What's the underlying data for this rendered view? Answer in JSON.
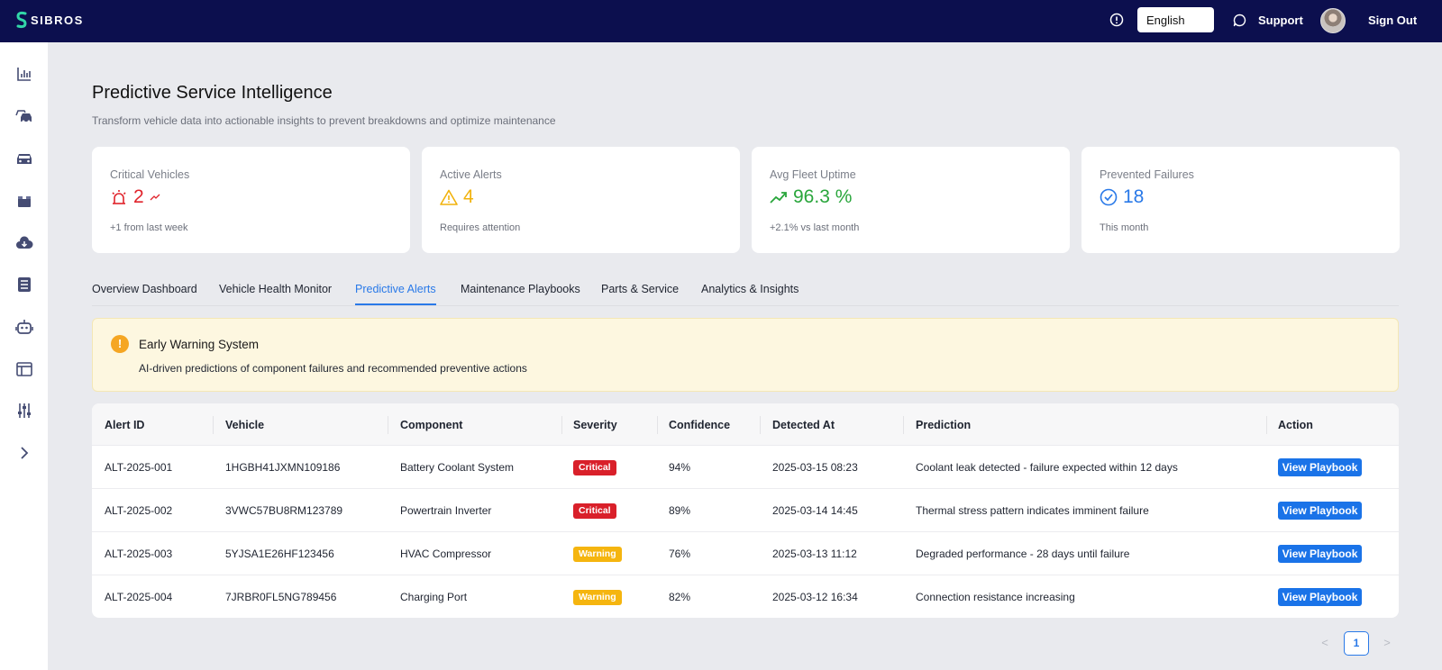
{
  "header": {
    "brand": "SIBROS",
    "language": "English",
    "support_label": "Support",
    "signout_label": "Sign Out"
  },
  "sidebar": {
    "icons": [
      "dashboard-chart-icon",
      "fleet-cars-icon",
      "vehicle-icon",
      "package-icon",
      "cloud-download-icon",
      "document-list-icon",
      "robot-icon",
      "layout-panel-icon",
      "sliders-icon",
      "expand-chevron-icon"
    ]
  },
  "page": {
    "title": "Predictive Service Intelligence",
    "subtitle": "Transform vehicle data into actionable insights to prevent breakdowns and optimize maintenance"
  },
  "cards": [
    {
      "label": "Critical Vehicles",
      "value": "2",
      "note": "+1 from last week",
      "icon": "alarm-icon",
      "color": "#e0232b"
    },
    {
      "label": "Active Alerts",
      "value": "4",
      "note": "Requires attention",
      "icon": "warning-icon",
      "color": "#f1b20c"
    },
    {
      "label": "Avg Fleet Uptime",
      "value": "96.3 %",
      "note": "+2.1% vs last month",
      "icon": "trend-up-icon",
      "color": "#2aa63c"
    },
    {
      "label": "Prevented Failures",
      "value": "18",
      "note": "This month",
      "icon": "check-circle-icon",
      "color": "#2979e8"
    }
  ],
  "tabs": [
    "Overview Dashboard",
    "Vehicle Health Monitor",
    "Predictive Alerts",
    "Maintenance Playbooks",
    "Parts & Service",
    "Analytics & Insights"
  ],
  "active_tab": "Predictive Alerts",
  "banner": {
    "title": "Early Warning System",
    "text": "AI-driven predictions of component failures and recommended preventive actions"
  },
  "table": {
    "columns": [
      "Alert ID",
      "Vehicle",
      "Component",
      "Severity",
      "Confidence",
      "Detected At",
      "Prediction",
      "Action"
    ],
    "rows": [
      {
        "id": "ALT-2025-001",
        "vehicle": "1HGBH41JXMN109186",
        "component": "Battery Coolant System",
        "severity": "Critical",
        "confidence": "94%",
        "detected": "2025-03-15 08:23",
        "prediction": "Coolant leak detected - failure expected within 12 days",
        "action": "View Playbook"
      },
      {
        "id": "ALT-2025-002",
        "vehicle": "3VWC57BU8RM123789",
        "component": "Powertrain Inverter",
        "severity": "Critical",
        "confidence": "89%",
        "detected": "2025-03-14 14:45",
        "prediction": "Thermal stress pattern indicates imminent failure",
        "action": "View Playbook"
      },
      {
        "id": "ALT-2025-003",
        "vehicle": "5YJSA1E26HF123456",
        "component": "HVAC Compressor",
        "severity": "Warning",
        "confidence": "76%",
        "detected": "2025-03-13 11:12",
        "prediction": "Degraded performance - 28 days until failure",
        "action": "View Playbook"
      },
      {
        "id": "ALT-2025-004",
        "vehicle": "7JRBR0FL5NG789456",
        "component": "Charging Port",
        "severity": "Warning",
        "confidence": "82%",
        "detected": "2025-03-12 16:34",
        "prediction": "Connection resistance increasing",
        "action": "View Playbook"
      }
    ]
  },
  "pagination": {
    "prev": "<",
    "current": "1",
    "next": ">"
  }
}
